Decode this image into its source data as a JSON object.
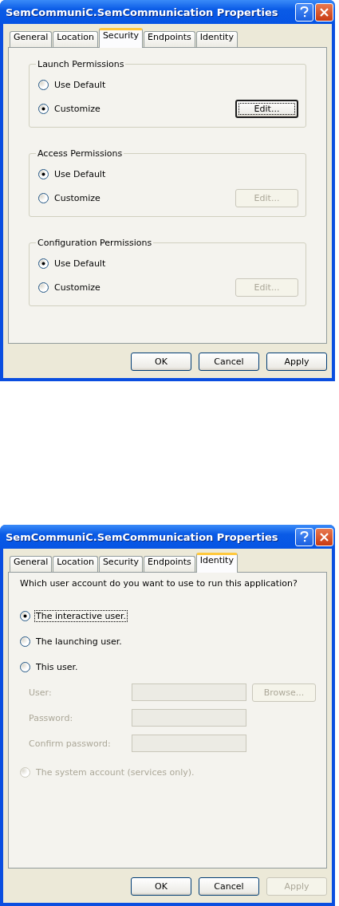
{
  "windows": [
    {
      "title": "SemCommuniC.SemCommunication Properties",
      "kind": "security",
      "tabs": [
        {
          "label": "General",
          "selected": false
        },
        {
          "label": "Location",
          "selected": false
        },
        {
          "label": "Security",
          "selected": true
        },
        {
          "label": "Endpoints",
          "selected": false
        },
        {
          "label": "Identity",
          "selected": false
        }
      ],
      "groups": [
        {
          "title": "Launch Permissions",
          "options": [
            {
              "label": "Use Default",
              "selected": false
            },
            {
              "label": "Customize",
              "selected": true
            }
          ],
          "edit": {
            "label": "Edit...",
            "disabled": false,
            "focused": true
          }
        },
        {
          "title": "Access Permissions",
          "options": [
            {
              "label": "Use Default",
              "selected": true
            },
            {
              "label": "Customize",
              "selected": false
            }
          ],
          "edit": {
            "label": "Edit...",
            "disabled": true,
            "focused": false
          }
        },
        {
          "title": "Configuration Permissions",
          "options": [
            {
              "label": "Use Default",
              "selected": true
            },
            {
              "label": "Customize",
              "selected": false
            }
          ],
          "edit": {
            "label": "Edit...",
            "disabled": true,
            "focused": false
          }
        }
      ],
      "buttons": [
        {
          "label": "OK",
          "disabled": false
        },
        {
          "label": "Cancel",
          "disabled": false
        },
        {
          "label": "Apply",
          "disabled": false
        }
      ]
    },
    {
      "title": "SemCommuniC.SemCommunication Properties",
      "kind": "identity",
      "tabs": [
        {
          "label": "General",
          "selected": false
        },
        {
          "label": "Location",
          "selected": false
        },
        {
          "label": "Security",
          "selected": false
        },
        {
          "label": "Endpoints",
          "selected": false
        },
        {
          "label": "Identity",
          "selected": true
        }
      ],
      "prompt": "Which user account do you want to use to run this application?",
      "items": [
        {
          "kind": "radio",
          "label": "The interactive user.",
          "selected": true,
          "disabled": false,
          "focused": true
        },
        {
          "kind": "radio",
          "label": "The launching user.",
          "selected": false,
          "disabled": false,
          "focused": false
        },
        {
          "kind": "radio",
          "label": "This user.",
          "selected": false,
          "disabled": false,
          "focused": false
        },
        {
          "kind": "field",
          "label": "User:",
          "disabled": true,
          "button": "Browse..."
        },
        {
          "kind": "field",
          "label": "Password:",
          "disabled": true
        },
        {
          "kind": "field",
          "label": "Confirm password:",
          "disabled": true
        },
        {
          "kind": "radio",
          "label": "The system account (services only).",
          "selected": false,
          "disabled": true,
          "focused": false
        }
      ],
      "buttons": [
        {
          "label": "OK",
          "disabled": false
        },
        {
          "label": "Cancel",
          "disabled": false
        },
        {
          "label": "Apply",
          "disabled": true
        }
      ]
    }
  ]
}
